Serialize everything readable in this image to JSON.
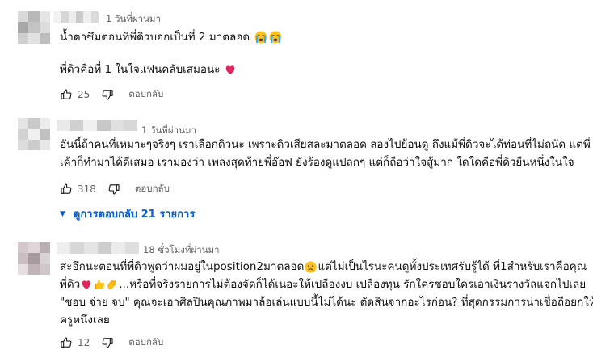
{
  "comments": [
    {
      "time": "1 วันที่ผ่านมา",
      "lines": [
        "น้ำตาซึมตอนที่พี่ดิวบอกเป็นที่ 2 มาตลอด",
        "",
        "พี่ดิวคือที่ 1 ในใจแฟนคลับเสมอนะ"
      ],
      "likes": "25",
      "reply_label": "ตอบกลับ"
    },
    {
      "time": "1 วันที่ผ่านมา",
      "lines": [
        "อันนี้ถ้าคนที่เหมาะๆจริงๆ เราเลือกดิวนะ เพราะดิวเสียสละมาตลอด ลองไปย้อนดู ถึงแม้พี่ดิวจะได้ท่อนที่ไม่ถนัด แต่พี่",
        "เค้าก็ทำมาได้ดีเสมอ เรามองว่า เพลงสุดท้ายพี่อ๊อฟ ยังร้องดูแปลกๆ แต่ก็ถือว่าใจสู้มาก ใดใดคือพี่ดิวยืนหนึ่งในใจ"
      ],
      "likes": "318",
      "reply_label": "ตอบกลับ",
      "replies_toggle": "ดูการตอบกลับ 21 รายการ"
    },
    {
      "time": "18 ชั่วโมงที่ผ่านมา",
      "lines": [
        "สะอึกนะตอนที่พี่ดิวพูดว่าผมอยู่ในposition2มาตลอด",
        "แต่ไม่เป็นไรนะคนดูทั้งประเทศรับรู้ได้ ที่1สำหรับเราคือคุณ",
        "พี่ดิว",
        "...หรือที่จริงรายการไม่ต้องจัดก็ได้เนอะให้เปลืองงบ เปลืองทุน รักใครชอบใครเอาเงินรางวัลแจกไปเลย",
        "\"ชอบ จ่าย จบ\" คุณจะเอาศิลปินคุณภาพมาล้อเล่นแบบนี้ไม่ได้นะ ตัดสินจากอะไรก่อน? ที่สุดกรรมการน่าเชื่อถือยกให้",
        "ครูหนึ่งเลย"
      ],
      "likes": "12",
      "reply_label": "ตอบกลับ"
    }
  ],
  "icons": [
    "thumbs-up-icon",
    "thumbs-down-icon",
    "red-heart-emoji",
    "crying-face-emoji",
    "confused-face-emoji",
    "thumbs-up-emoji",
    "clapping-hands-emoji",
    "caret-down-icon"
  ],
  "colors": {
    "link": "#065fd4",
    "meta": "#606060",
    "text": "#0f0f0f",
    "heart": "#e0245e"
  }
}
